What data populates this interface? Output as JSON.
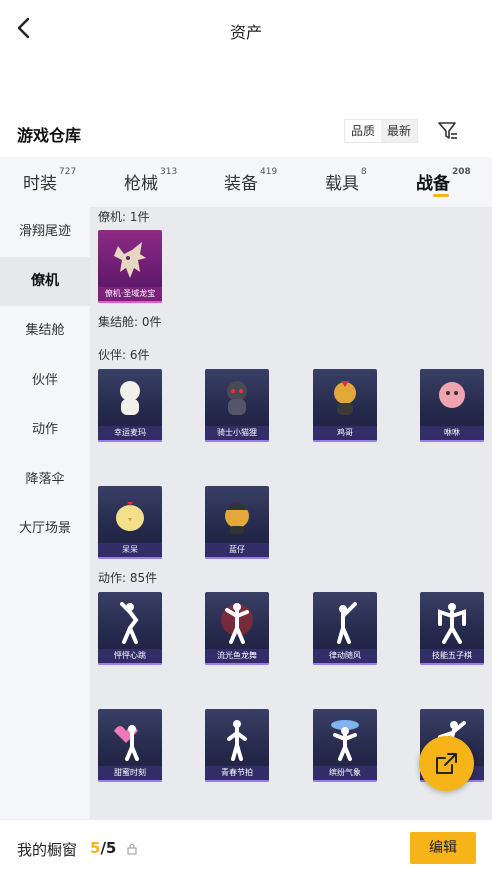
{
  "header": {
    "title": "资产"
  },
  "warehouse": {
    "title": "游戏仓库",
    "sort": {
      "quality": "品质",
      "latest": "最新"
    }
  },
  "tabs": [
    {
      "label": "时装",
      "count": "727"
    },
    {
      "label": "枪械",
      "count": "313"
    },
    {
      "label": "装备",
      "count": "419"
    },
    {
      "label": "载具",
      "count": "8"
    },
    {
      "label": "战备",
      "count": "208"
    }
  ],
  "sidebar": [
    "滑翔尾迹",
    "僚机",
    "集结舱",
    "伙伴",
    "动作",
    "降落伞",
    "大厅场景"
  ],
  "sections": {
    "wingman": {
      "label": "僚机: 1件",
      "items": [
        "僚机·圣域龙宝"
      ]
    },
    "pod": {
      "label": "集结舱: 0件"
    },
    "companion": {
      "label": "伙伴: 6件",
      "items": [
        "幸运麦玛",
        "骑士小猫狸",
        "鸡哥",
        "咻咻",
        "呆呆",
        "蓝仔"
      ]
    },
    "emote": {
      "label": "动作: 85件",
      "items": [
        "怦怦心跳",
        "流光鱼龙舞",
        "律动随风",
        "技能五子棋",
        "甜蜜时刻",
        "青春节拍",
        "缤纷气象",
        ""
      ]
    }
  },
  "bottom": {
    "label": "我的橱窗",
    "current": "5",
    "total": "/5",
    "edit": "编辑"
  },
  "colors": {
    "accent": "#f6b418",
    "legendary": "#8d2a86",
    "epic": "#3a3f66"
  }
}
